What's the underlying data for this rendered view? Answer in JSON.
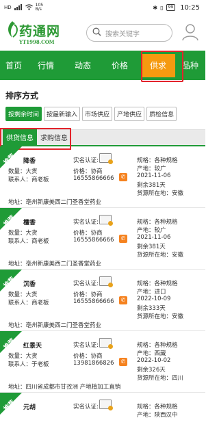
{
  "status_bar": {
    "signal": "HD",
    "speed": "105\nB/s",
    "battery": "99",
    "time": "10:25"
  },
  "header": {
    "logo_title": "药通网",
    "logo_url": "YT1998.COM",
    "search_placeholder": "搜索关键字"
  },
  "nav": {
    "items": [
      "首页",
      "行情",
      "动态",
      "价格",
      "供求",
      "品种"
    ]
  },
  "sort": {
    "title": "排序方式",
    "options": [
      "按剩余时间",
      "按最新输入",
      "市场供应",
      "产地供应",
      "质检信息"
    ]
  },
  "tabs": [
    "供货信息",
    "求购信息"
  ],
  "listings": [
    {
      "badge": "推荐",
      "name": "降香",
      "cert_label": "实名认证:",
      "qty": "数量：大货",
      "price": "价格：协商",
      "contact": "联系人：商老板",
      "phone": "16555866666",
      "spec": "规格：各种规格",
      "origin": "产地：较广",
      "date": "2021-11-06",
      "remain": "剩余381天",
      "source": "货源所在地：安徽",
      "address": "地址：亳州新康美西二门圣香堂药业"
    },
    {
      "badge": "推荐",
      "name": "檀香",
      "cert_label": "实名认证:",
      "qty": "数量：大货",
      "price": "价格：协商",
      "contact": "联系人：商老板",
      "phone": "16555866666",
      "spec": "规格：各种规格",
      "origin": "产地：较广",
      "date": "2021-11-06",
      "remain": "剩余381天",
      "source": "货源所在地：安徽",
      "address": "地址：亳州新康美西二门圣香堂药业"
    },
    {
      "badge": "推荐",
      "name": "沉香",
      "cert_label": "实名认证:",
      "qty": "数量：大货",
      "price": "价格：协商",
      "contact": "联系人：商老板",
      "phone": "16555866666",
      "spec": "规格：各种规格",
      "origin": "产地：进口",
      "date": "2022-10-09",
      "remain": "剩余333天",
      "source": "货源所在地：安徽",
      "address": "地址：亳州新康美西二门圣香堂药业"
    },
    {
      "badge": "推荐",
      "name": "红景天",
      "cert_label": "实名认证:",
      "qty": "数量：大货",
      "price": "价格：协商",
      "contact": "联系人：于老板",
      "phone": "13981866826",
      "spec": "规格：各种规格",
      "origin": "产地：西藏",
      "date": "2022-10-02",
      "remain": "剩余326天",
      "source": "货源所在地：四川",
      "address": "地址：四川省成都市甘孜洲 产地植加工直销"
    },
    {
      "badge": "推荐",
      "name": "元胡",
      "cert_label": "实名认证:",
      "spec": "规格：各种规格",
      "origin": "产地：陕西汉中"
    }
  ]
}
